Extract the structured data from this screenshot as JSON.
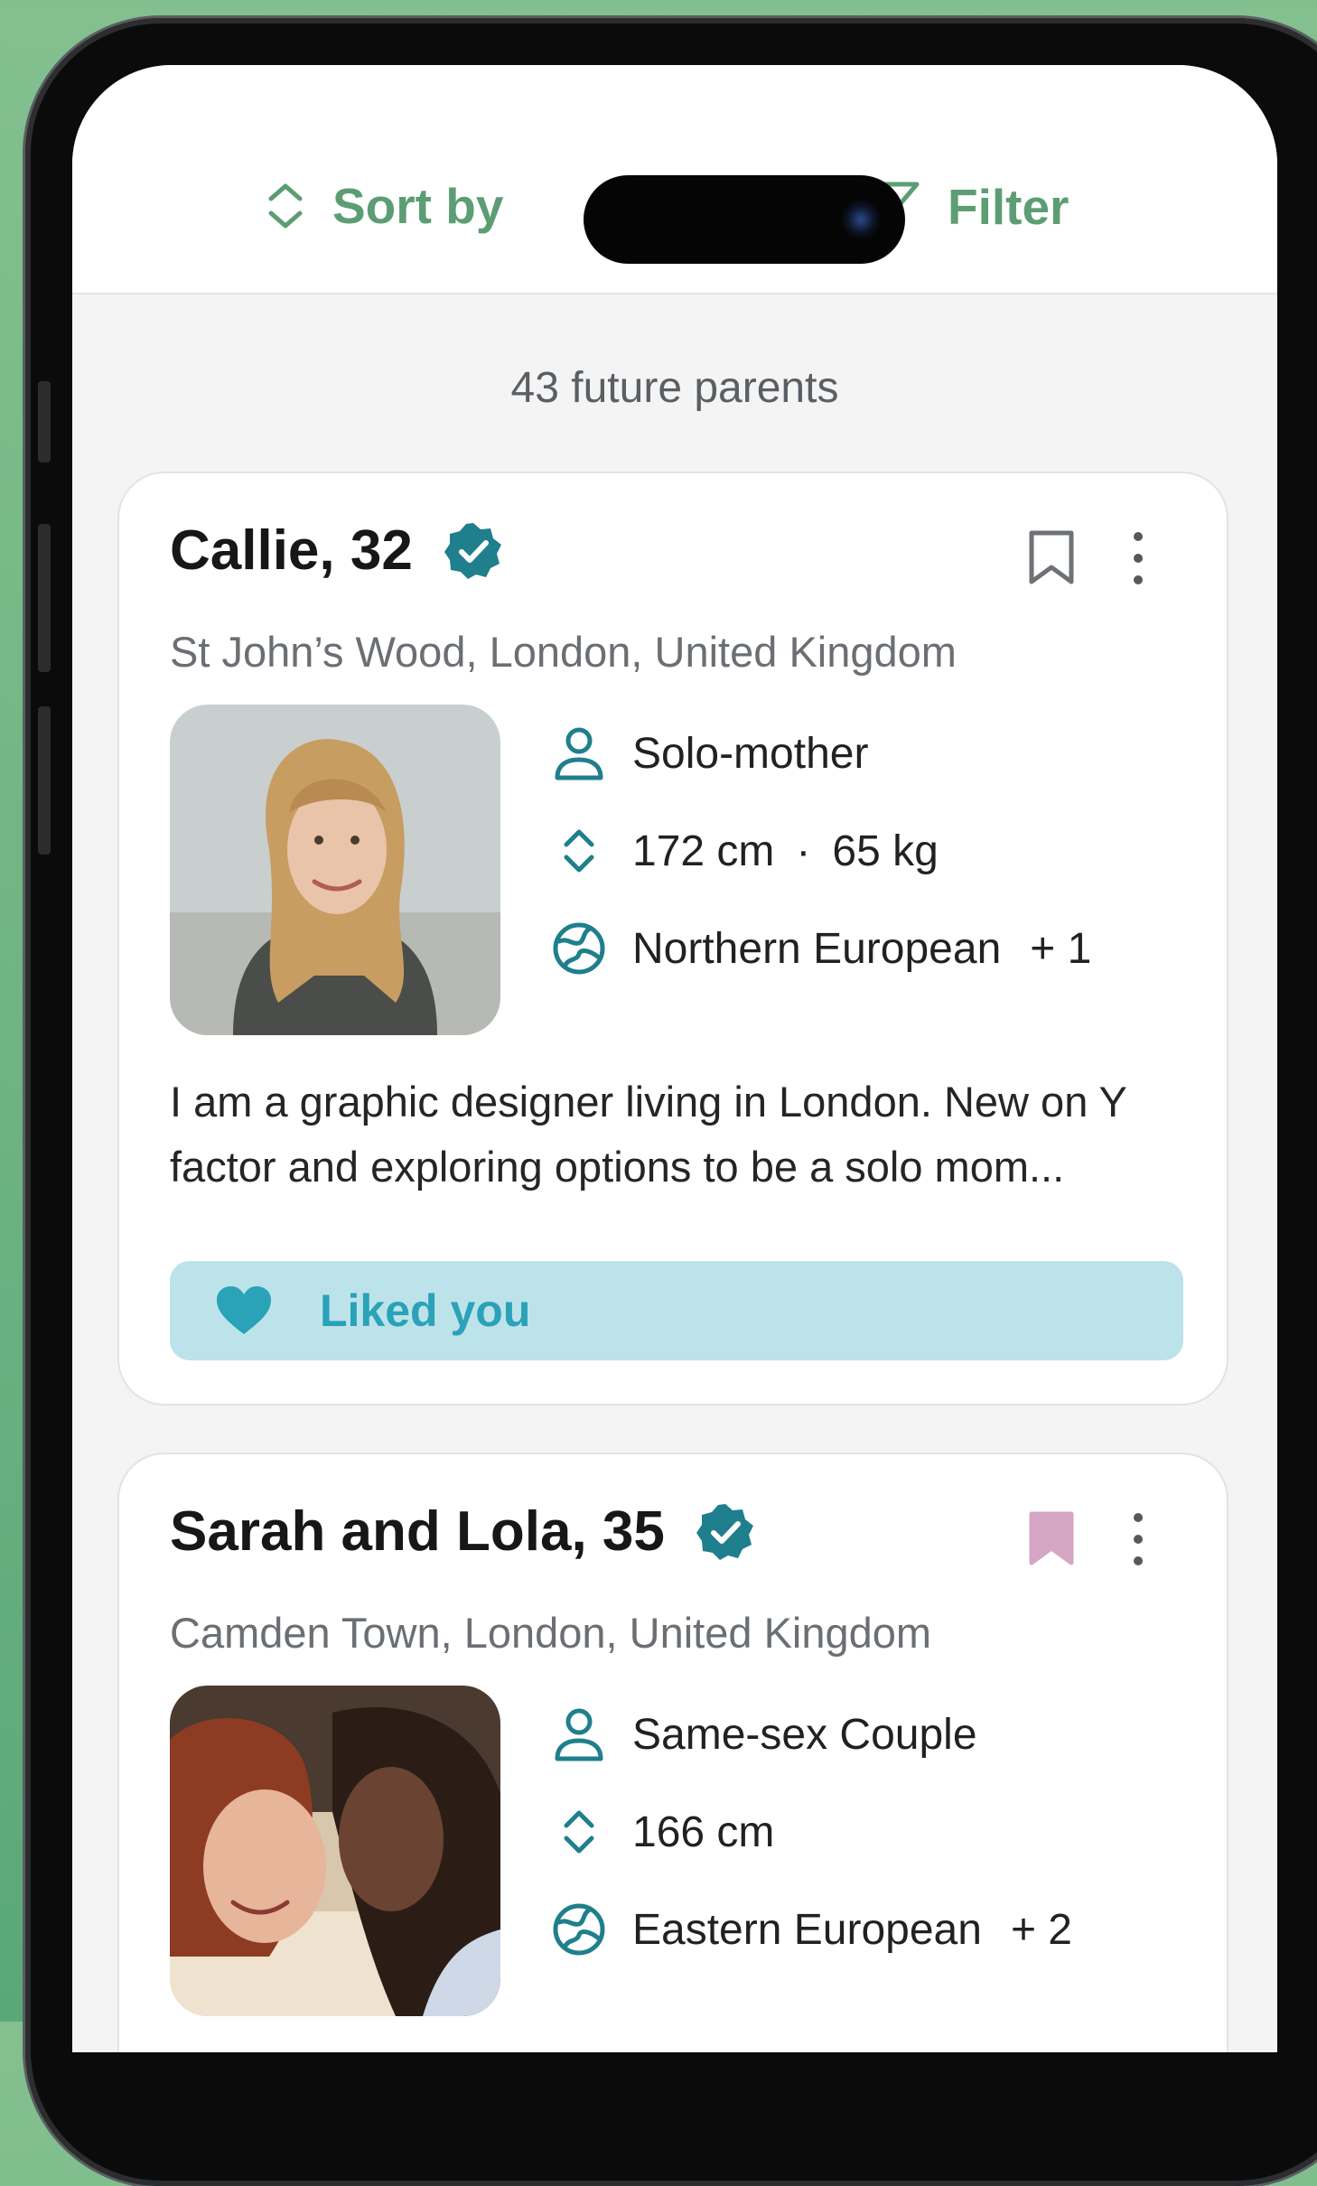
{
  "topbar": {
    "sort_label": "Sort by",
    "filter_label": "Filter"
  },
  "results": {
    "count_text": "43 future parents"
  },
  "colors": {
    "accent_green": "#5d9d74",
    "teal": "#1f7f8c",
    "liked_bg": "#bde3ea",
    "liked_text": "#2aa2b8",
    "saved_bookmark": "#d4a6c4"
  },
  "profiles": [
    {
      "name_age": "Callie, 32",
      "verified": true,
      "saved": false,
      "location": "St John’s Wood, London, United Kingdom",
      "family_type": "Solo-mother",
      "height": "172 cm",
      "separator": "·",
      "weight": "65 kg",
      "ethnicity": "Northern European",
      "ethnicity_more": "+ 1",
      "bio": "I am a graphic designer living in London. New on Y factor and exploring options to be a solo mom...",
      "liked_label": "Liked you"
    },
    {
      "name_age": "Sarah and Lola, 35",
      "verified": true,
      "saved": true,
      "location": "Camden Town, London, United Kingdom",
      "family_type": "Same-sex Couple",
      "height": "166 cm",
      "ethnicity": "Eastern European",
      "ethnicity_more": "+ 2"
    }
  ]
}
